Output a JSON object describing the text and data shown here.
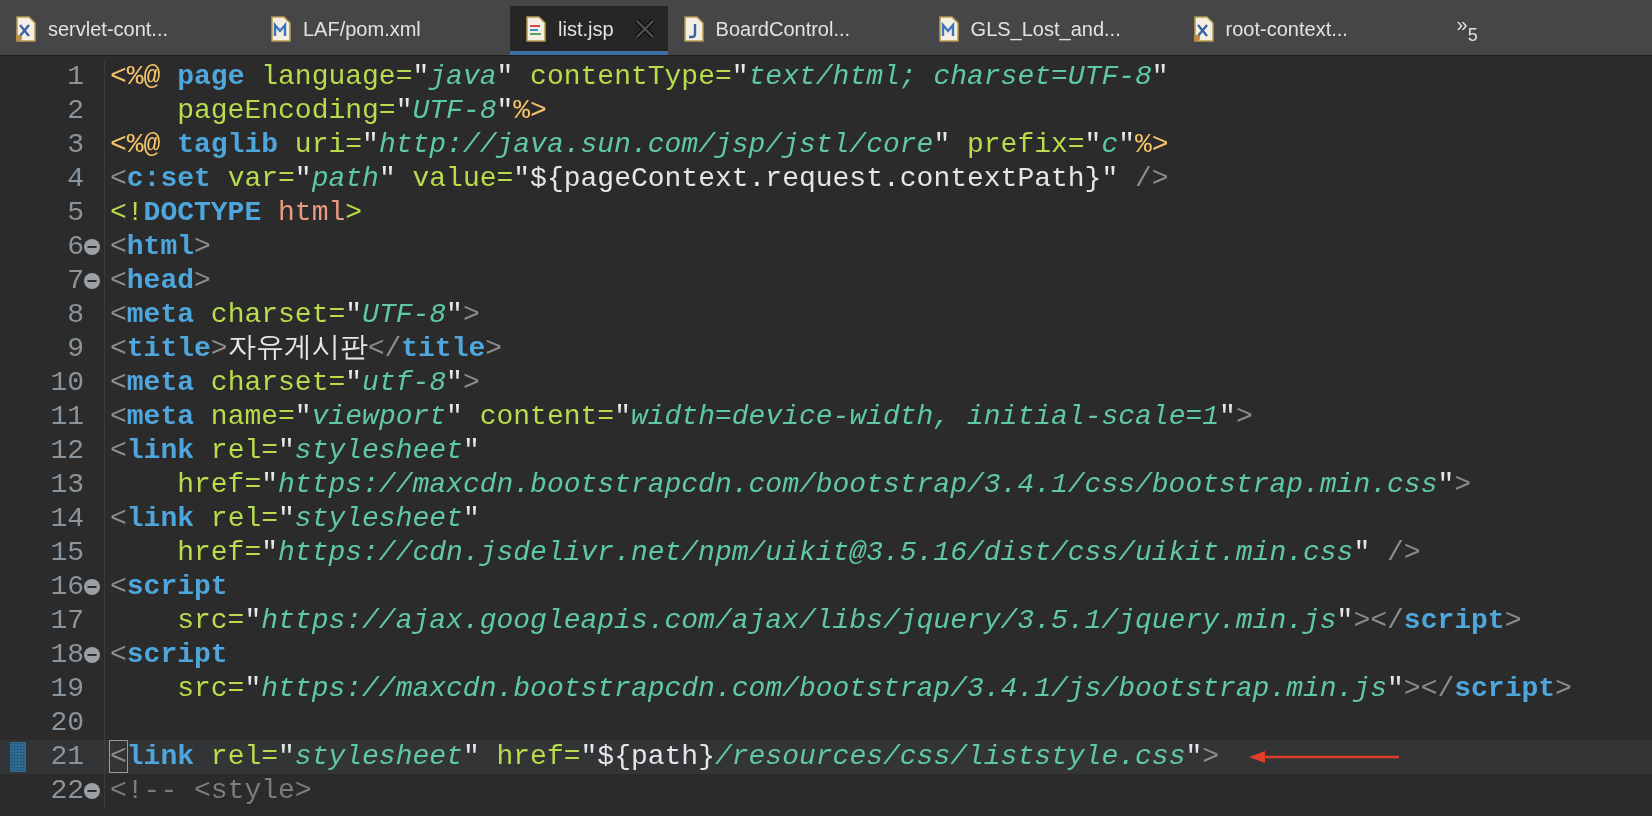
{
  "tabs": [
    {
      "label": "servlet-cont...",
      "kind": "xml",
      "selected": false
    },
    {
      "label": "LAF/pom.xml",
      "kind": "maven",
      "selected": false
    },
    {
      "label": "list.jsp",
      "kind": "jsp",
      "selected": true
    },
    {
      "label": "BoardControl...",
      "kind": "java",
      "selected": false
    },
    {
      "label": "GLS_Lost_and...",
      "kind": "maven",
      "selected": false
    },
    {
      "label": "root-context...",
      "kind": "xml",
      "selected": false
    }
  ],
  "overflow": {
    "glyph": "»",
    "count": "5"
  },
  "lines": [
    {
      "number": "1",
      "tokens": [
        {
          "kind": "delim",
          "text": "<%@"
        },
        {
          "kind": "tag",
          "text": " page"
        },
        {
          "kind": "attr",
          "text": " language="
        },
        {
          "kind": "text",
          "text": "\""
        },
        {
          "kind": "str",
          "text": "java"
        },
        {
          "kind": "text",
          "text": "\""
        },
        {
          "kind": "attr",
          "text": " contentType="
        },
        {
          "kind": "text",
          "text": "\""
        },
        {
          "kind": "str",
          "text": "text/html; charset=UTF-8"
        },
        {
          "kind": "text",
          "text": "\""
        }
      ]
    },
    {
      "number": "2",
      "tokens": [
        {
          "kind": "attr",
          "text": "    pageEncoding="
        },
        {
          "kind": "text",
          "text": "\""
        },
        {
          "kind": "str",
          "text": "UTF-8"
        },
        {
          "kind": "text",
          "text": "\""
        },
        {
          "kind": "delim",
          "text": "%>"
        }
      ]
    },
    {
      "number": "3",
      "tokens": [
        {
          "kind": "delim",
          "text": "<%@"
        },
        {
          "kind": "tag",
          "text": " taglib"
        },
        {
          "kind": "attr",
          "text": " uri="
        },
        {
          "kind": "text",
          "text": "\""
        },
        {
          "kind": "str",
          "text": "http://java.sun.com/jsp/jstl/core"
        },
        {
          "kind": "text",
          "text": "\""
        },
        {
          "kind": "attr",
          "text": " prefix="
        },
        {
          "kind": "text",
          "text": "\""
        },
        {
          "kind": "str",
          "text": "c"
        },
        {
          "kind": "text",
          "text": "\""
        },
        {
          "kind": "delim",
          "text": "%>"
        }
      ]
    },
    {
      "number": "4",
      "tokens": [
        {
          "kind": "punct",
          "text": "<"
        },
        {
          "kind": "tag",
          "text": "c:set"
        },
        {
          "kind": "attr",
          "text": " var="
        },
        {
          "kind": "text",
          "text": "\""
        },
        {
          "kind": "str",
          "text": "path"
        },
        {
          "kind": "text",
          "text": "\""
        },
        {
          "kind": "attr",
          "text": " value="
        },
        {
          "kind": "text",
          "text": "\"${pageContext.request.contextPath}\""
        },
        {
          "kind": "punct",
          "text": " />"
        }
      ]
    },
    {
      "number": "5",
      "tokens": [
        {
          "kind": "decl",
          "text": "<!"
        },
        {
          "kind": "tag",
          "text": "DOCTYPE"
        },
        {
          "kind": "doctype",
          "text": " html"
        },
        {
          "kind": "decl",
          "text": ">"
        }
      ]
    },
    {
      "number": "6",
      "folding": true,
      "tokens": [
        {
          "kind": "punct",
          "text": "<"
        },
        {
          "kind": "tag",
          "text": "html"
        },
        {
          "kind": "punct",
          "text": ">"
        }
      ]
    },
    {
      "number": "7",
      "folding": true,
      "tokens": [
        {
          "kind": "punct",
          "text": "<"
        },
        {
          "kind": "tag",
          "text": "head"
        },
        {
          "kind": "punct",
          "text": ">"
        }
      ]
    },
    {
      "number": "8",
      "tokens": [
        {
          "kind": "punct",
          "text": "<"
        },
        {
          "kind": "tag",
          "text": "meta"
        },
        {
          "kind": "attr",
          "text": " charset="
        },
        {
          "kind": "text",
          "text": "\""
        },
        {
          "kind": "str",
          "text": "UTF-8"
        },
        {
          "kind": "text",
          "text": "\""
        },
        {
          "kind": "punct",
          "text": ">"
        }
      ]
    },
    {
      "number": "9",
      "tokens": [
        {
          "kind": "punct",
          "text": "<"
        },
        {
          "kind": "tag",
          "text": "title"
        },
        {
          "kind": "punct",
          "text": ">"
        },
        {
          "kind": "text",
          "text": "자유게시판"
        },
        {
          "kind": "punct",
          "text": "</"
        },
        {
          "kind": "tag",
          "text": "title"
        },
        {
          "kind": "punct",
          "text": ">"
        }
      ]
    },
    {
      "number": "10",
      "tokens": [
        {
          "kind": "punct",
          "text": "<"
        },
        {
          "kind": "tag",
          "text": "meta"
        },
        {
          "kind": "attr",
          "text": " charset="
        },
        {
          "kind": "text",
          "text": "\""
        },
        {
          "kind": "str",
          "text": "utf-8"
        },
        {
          "kind": "text",
          "text": "\""
        },
        {
          "kind": "punct",
          "text": ">"
        }
      ]
    },
    {
      "number": "11",
      "tokens": [
        {
          "kind": "punct",
          "text": "<"
        },
        {
          "kind": "tag",
          "text": "meta"
        },
        {
          "kind": "attr",
          "text": " name="
        },
        {
          "kind": "text",
          "text": "\""
        },
        {
          "kind": "str",
          "text": "viewport"
        },
        {
          "kind": "text",
          "text": "\""
        },
        {
          "kind": "attr",
          "text": " content="
        },
        {
          "kind": "text",
          "text": "\""
        },
        {
          "kind": "str",
          "text": "width=device-width, initial-scale=1"
        },
        {
          "kind": "text",
          "text": "\""
        },
        {
          "kind": "punct",
          "text": ">"
        }
      ]
    },
    {
      "number": "12",
      "tokens": [
        {
          "kind": "punct",
          "text": "<"
        },
        {
          "kind": "tag",
          "text": "link"
        },
        {
          "kind": "attr",
          "text": " rel="
        },
        {
          "kind": "text",
          "text": "\""
        },
        {
          "kind": "str",
          "text": "stylesheet"
        },
        {
          "kind": "text",
          "text": "\""
        }
      ]
    },
    {
      "number": "13",
      "tokens": [
        {
          "kind": "attr",
          "text": "    href="
        },
        {
          "kind": "text",
          "text": "\""
        },
        {
          "kind": "str",
          "text": "https://maxcdn.bootstrapcdn.com/bootstrap/3.4.1/css/bootstrap.min.css"
        },
        {
          "kind": "text",
          "text": "\""
        },
        {
          "kind": "punct",
          "text": ">"
        }
      ]
    },
    {
      "number": "14",
      "tokens": [
        {
          "kind": "punct",
          "text": "<"
        },
        {
          "kind": "tag",
          "text": "link"
        },
        {
          "kind": "attr",
          "text": " rel="
        },
        {
          "kind": "text",
          "text": "\""
        },
        {
          "kind": "str",
          "text": "stylesheet"
        },
        {
          "kind": "text",
          "text": "\""
        }
      ]
    },
    {
      "number": "15",
      "tokens": [
        {
          "kind": "attr",
          "text": "    href="
        },
        {
          "kind": "text",
          "text": "\""
        },
        {
          "kind": "str",
          "text": "https://cdn.jsdelivr.net/npm/uikit@3.5.16/dist/css/uikit.min.css"
        },
        {
          "kind": "text",
          "text": "\""
        },
        {
          "kind": "punct",
          "text": " />"
        }
      ]
    },
    {
      "number": "16",
      "folding": true,
      "tokens": [
        {
          "kind": "punct",
          "text": "<"
        },
        {
          "kind": "tag",
          "text": "script"
        }
      ]
    },
    {
      "number": "17",
      "tokens": [
        {
          "kind": "attr",
          "text": "    src="
        },
        {
          "kind": "text",
          "text": "\""
        },
        {
          "kind": "str",
          "text": "https://ajax.googleapis.com/ajax/libs/jquery/3.5.1/jquery.min.js"
        },
        {
          "kind": "text",
          "text": "\""
        },
        {
          "kind": "punct",
          "text": "></"
        },
        {
          "kind": "tag",
          "text": "script"
        },
        {
          "kind": "punct",
          "text": ">"
        }
      ]
    },
    {
      "number": "18",
      "folding": true,
      "tokens": [
        {
          "kind": "punct",
          "text": "<"
        },
        {
          "kind": "tag",
          "text": "script"
        }
      ]
    },
    {
      "number": "19",
      "tokens": [
        {
          "kind": "attr",
          "text": "    src="
        },
        {
          "kind": "text",
          "text": "\""
        },
        {
          "kind": "str",
          "text": "https://maxcdn.bootstrapcdn.com/bootstrap/3.4.1/js/bootstrap.min.js"
        },
        {
          "kind": "text",
          "text": "\""
        },
        {
          "kind": "punct",
          "text": "></"
        },
        {
          "kind": "tag",
          "text": "script"
        },
        {
          "kind": "punct",
          "text": ">"
        }
      ]
    },
    {
      "number": "20"
    },
    {
      "number": "21",
      "current": true,
      "marker": true,
      "annotated": true,
      "tokens": [
        {
          "kind": "punct",
          "text": "<"
        },
        {
          "kind": "tag",
          "text": "link"
        },
        {
          "kind": "attr",
          "text": " rel="
        },
        {
          "kind": "text",
          "text": "\""
        },
        {
          "kind": "str",
          "text": "stylesheet"
        },
        {
          "kind": "text",
          "text": "\""
        },
        {
          "kind": "attr",
          "text": " href="
        },
        {
          "kind": "text",
          "text": "\"${path}"
        },
        {
          "kind": "str",
          "text": "/resources/css/liststyle.css"
        },
        {
          "kind": "text",
          "text": "\""
        },
        {
          "kind": "punct",
          "text": ">"
        }
      ]
    },
    {
      "number": "22",
      "folding": true,
      "tokens": [
        {
          "kind": "comment",
          "text": "<!-- <style>"
        }
      ]
    }
  ]
}
